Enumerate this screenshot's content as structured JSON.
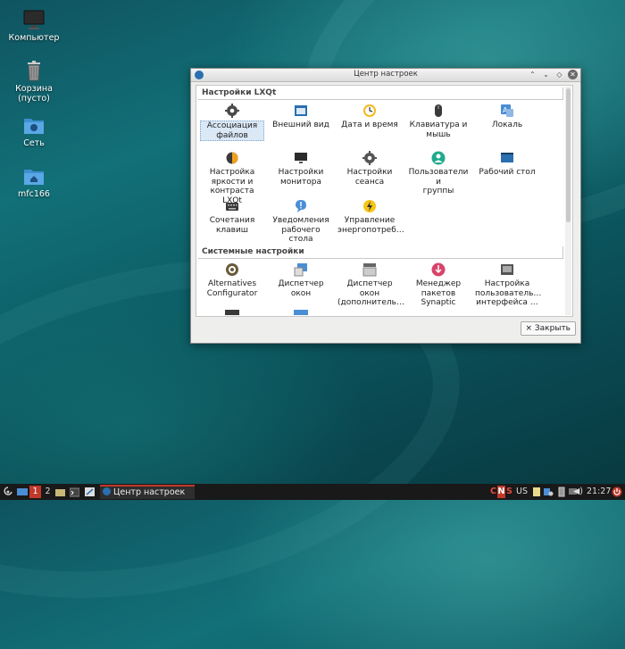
{
  "desktop": {
    "icons": [
      {
        "label": "Компьютер",
        "icon": "monitor-icon"
      },
      {
        "label": "Корзина\n(пусто)",
        "icon": "trash-icon"
      },
      {
        "label": "Сеть",
        "icon": "network-folder-icon"
      },
      {
        "label": "mfc166",
        "icon": "home-folder-icon"
      }
    ]
  },
  "window": {
    "title": "Центр настроек",
    "sections": [
      {
        "title": "Настройки LXQt",
        "items": [
          {
            "label": "Ассоциация\nфайлов",
            "icon": "gear-icon",
            "selected": true
          },
          {
            "label": "Внешний вид",
            "icon": "appearance-icon"
          },
          {
            "label": "Дата и время",
            "icon": "clock-icon"
          },
          {
            "label": "Клавиатура и\nмышь",
            "icon": "mouse-icon"
          },
          {
            "label": "Локаль",
            "icon": "locale-icon"
          },
          {
            "label": "Настройка\nяркости и\nконтраста LXQt",
            "icon": "brightness-icon"
          },
          {
            "label": "Настройки\nмонитора",
            "icon": "monitor-icon"
          },
          {
            "label": "Настройки\nсеанса",
            "icon": "session-gear-icon"
          },
          {
            "label": "Пользователи и\nгруппы",
            "icon": "users-icon"
          },
          {
            "label": "Рабочий стол",
            "icon": "desktop-icon"
          },
          {
            "label": "Сочетания\nклавиш",
            "icon": "keyboard-icon"
          },
          {
            "label": "Уведомления\nрабочего стола",
            "icon": "notification-icon"
          },
          {
            "label": "Управление\nэнергопотреб…",
            "icon": "power-icon"
          }
        ]
      },
      {
        "title": "Системные настройки",
        "items": [
          {
            "label": "Alternatives\nConfigurator",
            "icon": "alternatives-icon"
          },
          {
            "label": "Диспетчер\nокон",
            "icon": "window-manager-icon"
          },
          {
            "label": "Диспетчер\nокон\n(дополнитель…",
            "icon": "window-manager-advanced-icon"
          },
          {
            "label": "Менеджер\nпакетов\nSynaptic",
            "icon": "synaptic-icon"
          },
          {
            "label": "Настройка\nпользователь…\nинтерфейса …",
            "icon": "ui-settings-icon"
          }
        ]
      }
    ],
    "close_button": "× Закрыть"
  },
  "taskbar": {
    "workspace_active": "1",
    "workspace_2": "2",
    "task_title": "Центр настроек",
    "tray_letters": [
      "C",
      "N",
      "S"
    ],
    "keyboard_layout": "US",
    "clock": "21:27",
    "colors": {
      "bg": "#191919",
      "active_workspace": "#c0392b",
      "accent": "#2a6fb0"
    }
  }
}
